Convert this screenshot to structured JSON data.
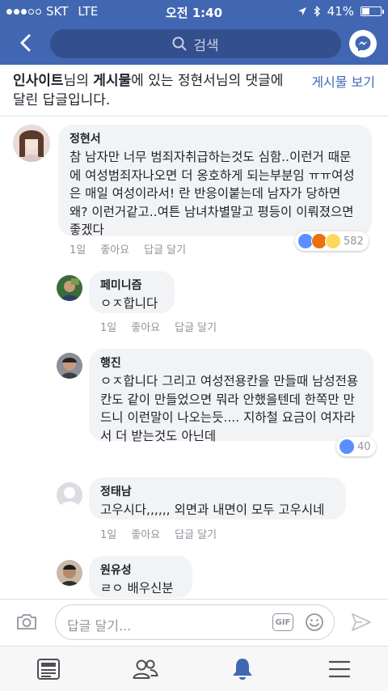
{
  "status_bar": {
    "carrier": "SKT",
    "network": "LTE",
    "time": "오전 1:40",
    "battery": "41%"
  },
  "navbar": {
    "search_placeholder": "검색"
  },
  "header": {
    "page_name": "인사이트",
    "text_1": "님의 ",
    "post_word": "게시물",
    "text_2": "에 있는 정현서님의 댓글에 달린 답글입니다.",
    "view_post": "게시물 보기"
  },
  "comments": [
    {
      "name": "정현서",
      "body": "참 남자만 너무 범죄자취급하는것도 심함..이런거 때문에 여성범죄자나오면 더 옹호하게 되는부분임 ㅠㅠ여성은 매일 여성이라서! 란 반응이붙는데 남자가 당하면 왜? 이런거같고..여튼 남녀차별말고 평등이 이뤄졌으면 좋겠다",
      "time": "1일",
      "like": "좋아요",
      "reply": "답글 달기",
      "reaction_count": "582"
    },
    {
      "name": "페미니즘",
      "body": "ㅇㅈ합니다",
      "time": "1일",
      "like": "좋아요",
      "reply": "답글 달기"
    },
    {
      "name": "행진",
      "body": "ㅇㅈ합니다 그리고 여성전용칸을 만들때 남성전용칸도 같이 만들었으면 뭐라 안했을텐데 한쪽만 만드니 이런말이 나오는듯.... 지하철 요금이 여자라서 더 받는것도 아닌데",
      "reaction_count": "40"
    },
    {
      "name": "정태남",
      "body": "고우시다,,,,,, 외면과 내면이 모두 고우시네",
      "time": "1일",
      "like": "좋아요",
      "reply": "답글 달기"
    },
    {
      "name": "원유성",
      "body": "ㄹㅇ 배우신분"
    }
  ],
  "input": {
    "placeholder": "답글 달기...",
    "gif_label": "GIF"
  },
  "colors": {
    "brand": "#4267b2",
    "bubble": "#f2f3f5",
    "meta": "#90949c"
  }
}
